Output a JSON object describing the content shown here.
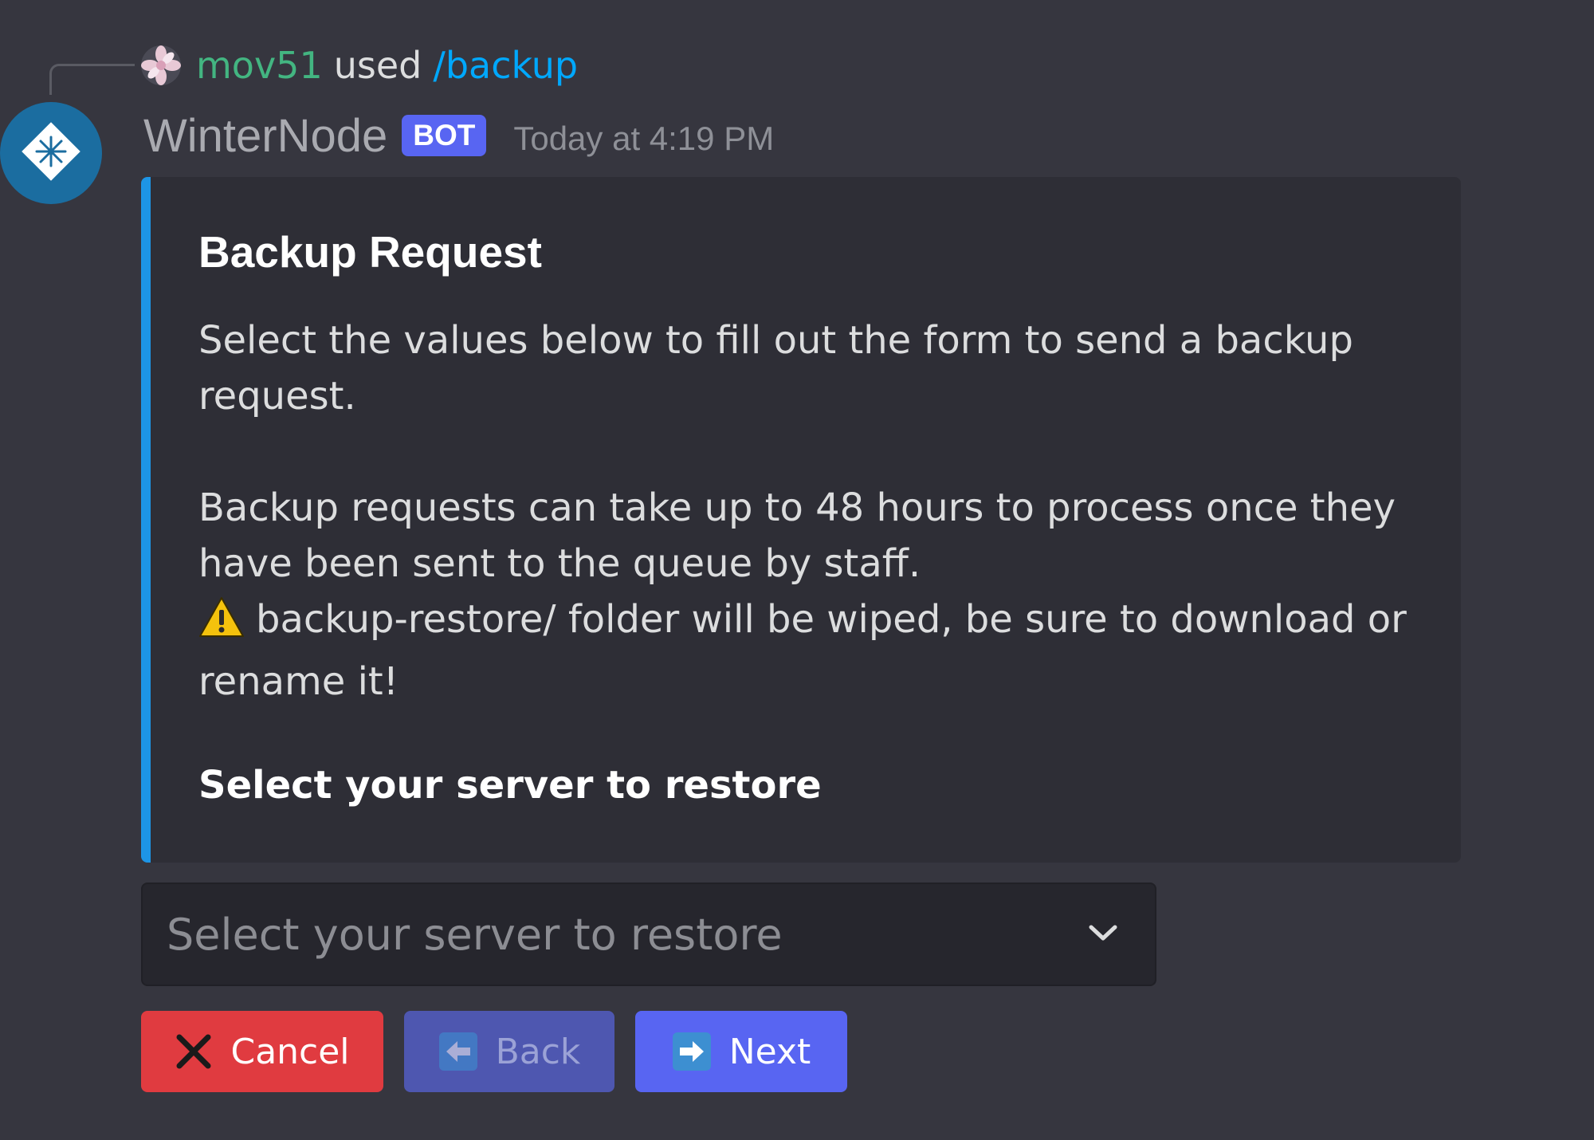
{
  "reply": {
    "user": "mov51",
    "used": "used",
    "command": "/backup",
    "avatar_icon": "flower-avatar-icon"
  },
  "message": {
    "author": "WinterNode",
    "bot_tag": "BOT",
    "timestamp": "Today at 4:19 PM",
    "avatar_icon": "snowflake-icon"
  },
  "embed": {
    "accent_color": "#1d95e6",
    "title": "Backup Request",
    "desc_line1": "Select the values below to fill out the form to send a backup request.",
    "desc_line2": "Backup requests can take up to 48 hours to process once they have been sent to the queue by staff.",
    "desc_warning": "backup-restore/ folder will be wiped, be sure to download or rename it!",
    "warning_icon": "warning-icon",
    "field_name": "Select your server to restore"
  },
  "select": {
    "placeholder": "Select your server to restore",
    "icon": "chevron-down-icon"
  },
  "buttons": {
    "cancel_label": "Cancel",
    "back_label": "Back",
    "next_label": "Next",
    "cancel_color": "#e03b40",
    "back_color": "#4e57b0",
    "next_color": "#5865f2"
  }
}
